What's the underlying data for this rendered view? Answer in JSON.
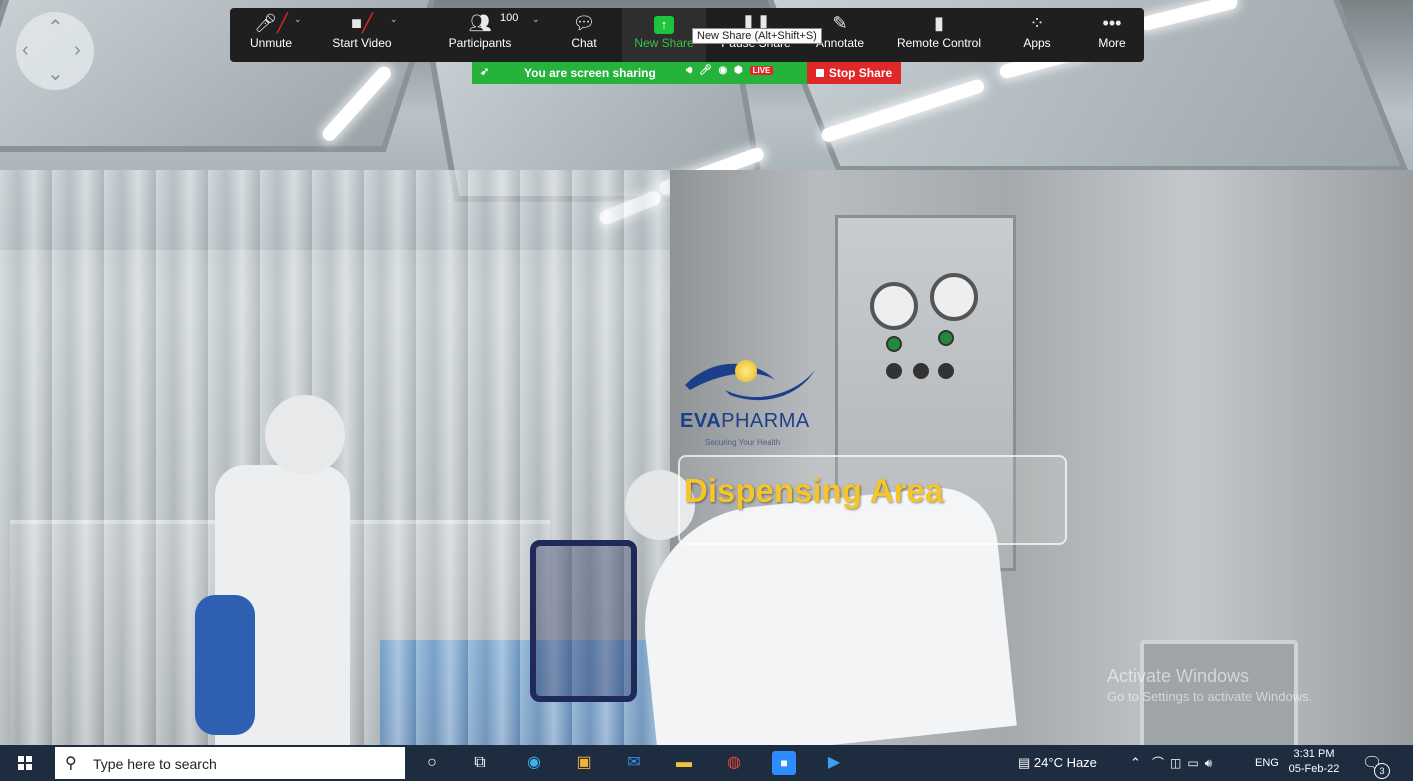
{
  "scene": {
    "logo": {
      "brand_bold": "EVA",
      "brand_thin": "PHARMA",
      "tagline": "Securing Your Health"
    },
    "area_label": "Dispensing Area",
    "activation_title": "Activate Windows",
    "activation_sub": "Go to Settings to activate Windows."
  },
  "zoom_toolbar": {
    "unmute": "Unmute",
    "start_video": "Start Video",
    "participants": "Participants",
    "participants_count": "100",
    "chat": "Chat",
    "new_share": "New Share",
    "pause_share": "Pause Share",
    "annotate": "Annotate",
    "remote_control": "Remote Control",
    "apps": "Apps",
    "more": "More",
    "tooltip": "New Share (Alt+Shift+S)"
  },
  "share_bar": {
    "status": "You are screen sharing",
    "live": "LIVE",
    "stop": "Stop Share"
  },
  "taskbar": {
    "search_placeholder": "Type here to search",
    "weather": "24°C  Haze",
    "lang": "ENG",
    "time": "3:31 PM",
    "date": "05-Feb-22",
    "notifications": "3"
  }
}
